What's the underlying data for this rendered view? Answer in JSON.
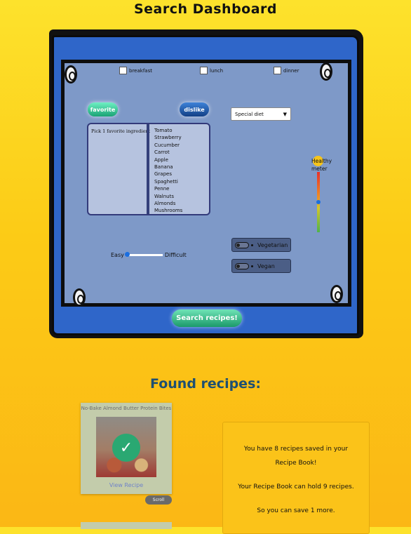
{
  "page": {
    "title": "Search Dashboard",
    "found_title": "Found recipes:"
  },
  "meals": [
    "breakfast",
    "lunch",
    "dinner"
  ],
  "buttons": {
    "favorite": "favorite",
    "dislike": "dislike",
    "search": "Search recipes!"
  },
  "diet_select": {
    "selected": "Special diet"
  },
  "ingredients": {
    "prompt": "Pick 1 favorite ingredient",
    "items": [
      "Tomato",
      "Strawberry",
      "Cucumber",
      "Carrot",
      "Apple",
      "Banana",
      "Grapes",
      "Spaghetti",
      "Penne",
      "Walnuts",
      "Almonds",
      "Mushrooms"
    ]
  },
  "health_meter": {
    "label_line1": "Healthy",
    "label_line2": "meter",
    "level": 0.5
  },
  "difficulty": {
    "easy": "Easy",
    "difficult": "Difficult",
    "value": 0
  },
  "toggles": [
    {
      "label": "Vegetarian"
    },
    {
      "label": "Vegan"
    }
  ],
  "recipe_card": {
    "title": "No-Bake Almond Butter Protein Bites",
    "link": "View Recipe",
    "scroll_button": "Scroll"
  },
  "info": {
    "line1": "You have 8 recipes saved in your Recipe Book!",
    "line2": "Your Recipe Book can hold 9 recipes.",
    "line3": "So you can save 1 more."
  },
  "colors": {
    "background": "#fcd21f",
    "board_blue": "#2f66c9",
    "board_inner": "#7e99c8",
    "accent_green": "#1b9a6a"
  }
}
